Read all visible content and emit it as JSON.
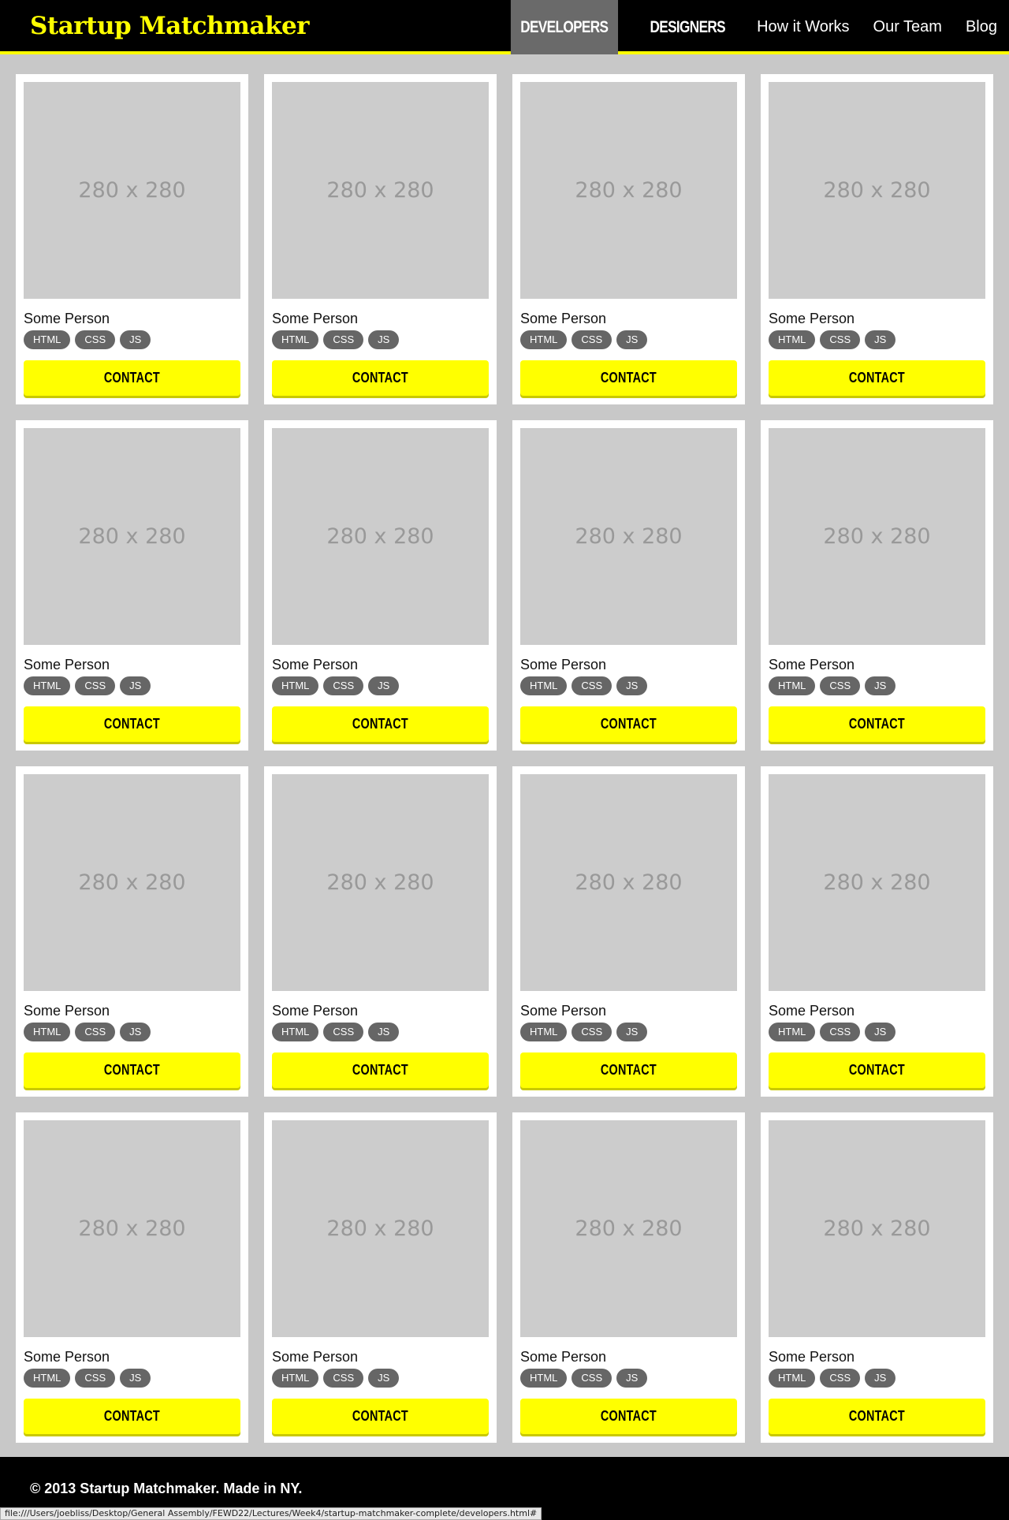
{
  "header": {
    "logo": "Startup Matchmaker",
    "nav": [
      {
        "label": "DEVELOPERS",
        "active": true
      },
      {
        "label": "DESIGNERS",
        "active": false
      },
      {
        "label": "How it Works",
        "active": false
      },
      {
        "label": "Our Team",
        "active": false
      },
      {
        "label": "Blog",
        "active": false
      }
    ]
  },
  "cards": [
    {
      "image": "280 x 280",
      "name": "Some Person",
      "tags": [
        "HTML",
        "CSS",
        "JS"
      ],
      "button": "CONTACT"
    },
    {
      "image": "280 x 280",
      "name": "Some Person",
      "tags": [
        "HTML",
        "CSS",
        "JS"
      ],
      "button": "CONTACT"
    },
    {
      "image": "280 x 280",
      "name": "Some Person",
      "tags": [
        "HTML",
        "CSS",
        "JS"
      ],
      "button": "CONTACT"
    },
    {
      "image": "280 x 280",
      "name": "Some Person",
      "tags": [
        "HTML",
        "CSS",
        "JS"
      ],
      "button": "CONTACT"
    },
    {
      "image": "280 x 280",
      "name": "Some Person",
      "tags": [
        "HTML",
        "CSS",
        "JS"
      ],
      "button": "CONTACT"
    },
    {
      "image": "280 x 280",
      "name": "Some Person",
      "tags": [
        "HTML",
        "CSS",
        "JS"
      ],
      "button": "CONTACT"
    },
    {
      "image": "280 x 280",
      "name": "Some Person",
      "tags": [
        "HTML",
        "CSS",
        "JS"
      ],
      "button": "CONTACT"
    },
    {
      "image": "280 x 280",
      "name": "Some Person",
      "tags": [
        "HTML",
        "CSS",
        "JS"
      ],
      "button": "CONTACT"
    },
    {
      "image": "280 x 280",
      "name": "Some Person",
      "tags": [
        "HTML",
        "CSS",
        "JS"
      ],
      "button": "CONTACT"
    },
    {
      "image": "280 x 280",
      "name": "Some Person",
      "tags": [
        "HTML",
        "CSS",
        "JS"
      ],
      "button": "CONTACT"
    },
    {
      "image": "280 x 280",
      "name": "Some Person",
      "tags": [
        "HTML",
        "CSS",
        "JS"
      ],
      "button": "CONTACT"
    },
    {
      "image": "280 x 280",
      "name": "Some Person",
      "tags": [
        "HTML",
        "CSS",
        "JS"
      ],
      "button": "CONTACT"
    },
    {
      "image": "280 x 280",
      "name": "Some Person",
      "tags": [
        "HTML",
        "CSS",
        "JS"
      ],
      "button": "CONTACT"
    },
    {
      "image": "280 x 280",
      "name": "Some Person",
      "tags": [
        "HTML",
        "CSS",
        "JS"
      ],
      "button": "CONTACT"
    },
    {
      "image": "280 x 280",
      "name": "Some Person",
      "tags": [
        "HTML",
        "CSS",
        "JS"
      ],
      "button": "CONTACT"
    },
    {
      "image": "280 x 280",
      "name": "Some Person",
      "tags": [
        "HTML",
        "CSS",
        "JS"
      ],
      "button": "CONTACT"
    }
  ],
  "footer": {
    "text": "© 2013 Startup Matchmaker. Made in NY."
  },
  "status_bar": {
    "url": "file:///Users/joebliss/Desktop/General Assembly/FEWD22/Lectures/Week4/startup-matchmaker-complete/developers.html#"
  },
  "colors": {
    "accent": "#ffff00",
    "header_bg": "#000000",
    "page_bg": "#c8c8c8",
    "tag_bg": "#666666",
    "active_nav_bg": "#6a6a6a"
  }
}
